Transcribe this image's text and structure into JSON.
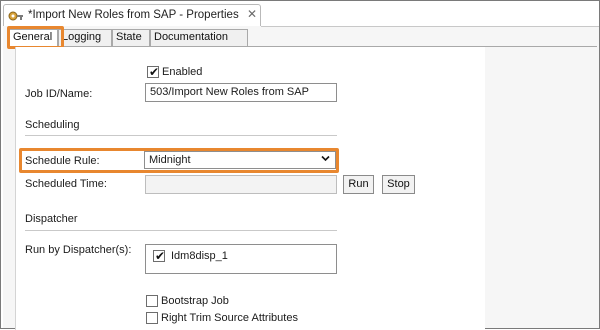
{
  "window": {
    "title": "*Import New Roles from SAP - Properties",
    "close_glyph": "✕"
  },
  "tabs": [
    {
      "label": "General",
      "active": true
    },
    {
      "label": "Logging",
      "active": false
    },
    {
      "label": "State",
      "active": false
    },
    {
      "label": "Documentation",
      "active": false
    }
  ],
  "general": {
    "enabled_label": "Enabled",
    "enabled_checked": true,
    "job_label": "Job ID/Name:",
    "job_value": "503/Import New Roles from SAP",
    "scheduling_heading": "Scheduling",
    "schedule_rule_label": "Schedule Rule:",
    "schedule_rule_value": "Midnight",
    "scheduled_time_label": "Scheduled Time:",
    "scheduled_time_value": "",
    "run_label": "Run",
    "stop_label": "Stop",
    "dispatcher_heading": "Dispatcher",
    "run_by_label": "Run by Dispatcher(s):",
    "dispatchers": [
      {
        "name": "Idm8disp_1",
        "checked": true
      }
    ],
    "bootstrap_label": "Bootstrap Job",
    "bootstrap_checked": false,
    "right_trim_label": "Right Trim Source Attributes",
    "right_trim_checked": false
  },
  "colors": {
    "highlight": "#e8872f"
  },
  "icons": {
    "title": "properties-icon",
    "close": "close-icon",
    "dropdown": "chevron-down-icon"
  }
}
